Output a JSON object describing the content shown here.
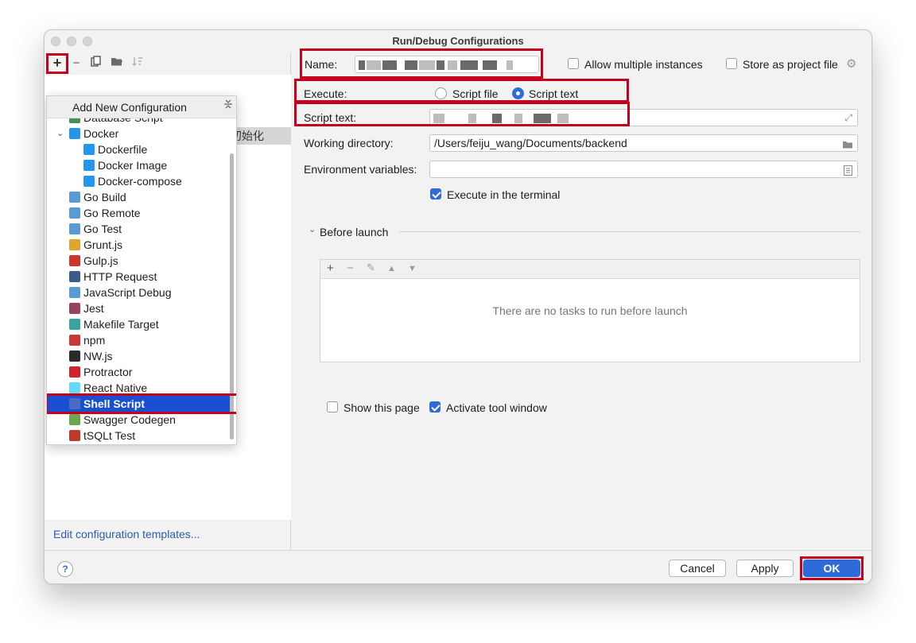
{
  "window": {
    "title": "Run/Debug Configurations"
  },
  "left_toolbar": {
    "add_icon": "plus-icon",
    "remove_icon": "minus-icon",
    "copy_icon": "copy-icon",
    "folder_icon": "new-folder-icon",
    "sort_icon": "sort-icon"
  },
  "left_panel": {
    "partial_item": "初始化",
    "edit_templates_link": "Edit configuration templates..."
  },
  "popup": {
    "title": "Add New Configuration",
    "items": [
      {
        "label": "Database Script",
        "icon": "database-script-icon",
        "color": "#4a8f5b"
      },
      {
        "label": "Docker",
        "icon": "docker-icon",
        "color": "#2496ed"
      },
      {
        "label": "Dockerfile",
        "icon": "docker-icon",
        "color": "#2496ed"
      },
      {
        "label": "Docker Image",
        "icon": "docker-icon",
        "color": "#2496ed"
      },
      {
        "label": "Docker-compose",
        "icon": "docker-icon",
        "color": "#2496ed"
      },
      {
        "label": "Go Build",
        "icon": "go-build-icon",
        "color": "#5b9bd5"
      },
      {
        "label": "Go Remote",
        "icon": "go-remote-icon",
        "color": "#5b9bd5"
      },
      {
        "label": "Go Test",
        "icon": "go-test-icon",
        "color": "#5b9bd5"
      },
      {
        "label": "Grunt.js",
        "icon": "grunt-icon",
        "color": "#e2a52b"
      },
      {
        "label": "Gulp.js",
        "icon": "gulp-icon",
        "color": "#d0352e"
      },
      {
        "label": "HTTP Request",
        "icon": "api-icon",
        "color": "#3a5a8c"
      },
      {
        "label": "JavaScript Debug",
        "icon": "javascript-debug-icon",
        "color": "#5b9bd5"
      },
      {
        "label": "Jest",
        "icon": "jest-icon",
        "color": "#99425b"
      },
      {
        "label": "Makefile Target",
        "icon": "makefile-icon",
        "color": "#3aa3a3"
      },
      {
        "label": "npm",
        "icon": "npm-icon",
        "color": "#cb3837"
      },
      {
        "label": "NW.js",
        "icon": "nwjs-icon",
        "color": "#2b2b2b"
      },
      {
        "label": "Protractor",
        "icon": "protractor-icon",
        "color": "#d3222c"
      },
      {
        "label": "React Native",
        "icon": "react-icon",
        "color": "#61dafb"
      },
      {
        "label": "Shell Script",
        "icon": "shell-script-icon",
        "color": "#4a6bbf"
      },
      {
        "label": "Swagger Codegen",
        "icon": "swagger-icon",
        "color": "#6aa84f"
      },
      {
        "label": "tSQLt Test",
        "icon": "tsqlt-icon",
        "color": "#c0392b"
      }
    ]
  },
  "form": {
    "name_label": "Name:",
    "allow_multiple_label": "Allow multiple instances",
    "store_project_label": "Store as project file",
    "execute_label": "Execute:",
    "script_file_label": "Script file",
    "script_text_option_label": "Script text",
    "script_text_label": "Script text:",
    "working_dir_label": "Working directory:",
    "working_dir_value": "/Users/feiju_wang/Documents/backend",
    "env_vars_label": "Environment variables:",
    "execute_terminal_label": "Execute in the terminal",
    "before_launch_label": "Before launch",
    "no_tasks_message": "There are no tasks to run before launch",
    "show_page_label": "Show this page",
    "activate_tool_label": "Activate tool window"
  },
  "buttons": {
    "help": "?",
    "cancel": "Cancel",
    "apply": "Apply",
    "ok": "OK"
  },
  "colors": {
    "accent": "#2f6bd8",
    "highlight_box": "#c4001c",
    "selection": "#1a4fd1"
  }
}
